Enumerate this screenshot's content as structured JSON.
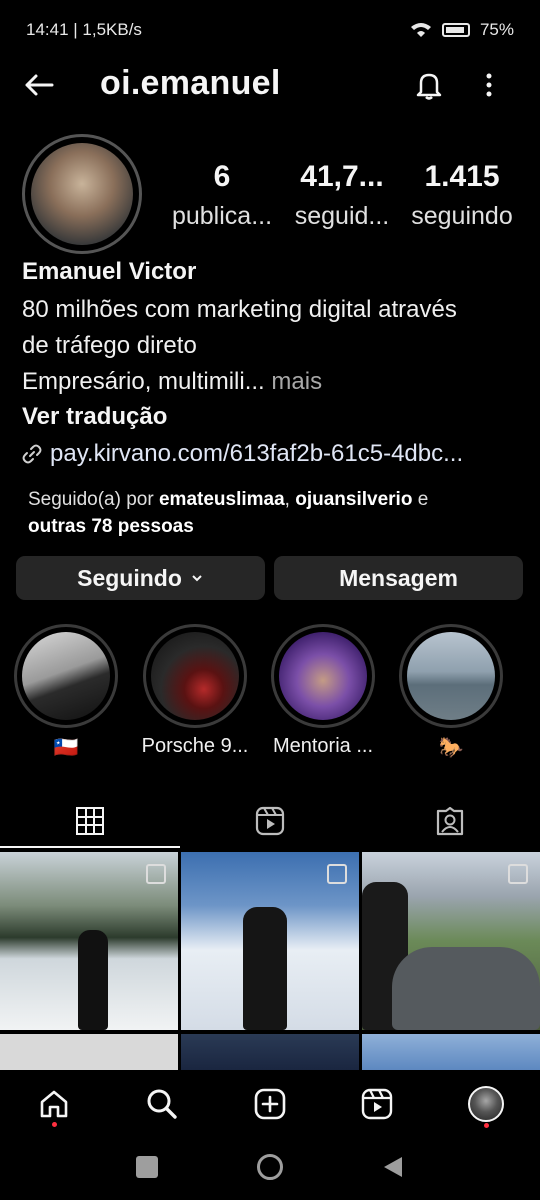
{
  "status": {
    "time_speed": "14:41 | 1,5KB/s",
    "battery": "75",
    "battery_level": 0.75
  },
  "header": {
    "username": "oi.emanuel"
  },
  "stats": [
    {
      "value": "6",
      "label": "publica..."
    },
    {
      "value": "41,7...",
      "label": "seguid..."
    },
    {
      "value": "1.415",
      "label": "seguindo"
    }
  ],
  "profile": {
    "name": "Emanuel Victor",
    "bio_line1": "80 milhões com marketing digital através",
    "bio_line2": "de tráfego direto",
    "bio_line3": "Empresário, multimili...",
    "more": "mais",
    "translate": "Ver tradução",
    "link": "pay.kirvano.com/613faf2b-61c5-4dbc..."
  },
  "followed_by": {
    "prefix": "Seguido(a) por",
    "user1": "emateuslimaa",
    "sep": ",",
    "user2": "ojuansilverio",
    "and": "e",
    "others": "outras 78 pessoas"
  },
  "buttons": {
    "following": "Seguindo",
    "message": "Mensagem"
  },
  "highlights": [
    {
      "label": "🇨🇱"
    },
    {
      "label": "Porsche 9..."
    },
    {
      "label": "Mentoria ..."
    },
    {
      "label": "🐎"
    }
  ],
  "colors": {
    "background": "#000000",
    "button": "#262626",
    "notification": "#ff3040"
  },
  "icons": [
    "back-arrow-icon",
    "bell-icon",
    "more-icon",
    "link-icon",
    "chevron-down-icon",
    "grid-icon",
    "reels-icon",
    "tagged-icon",
    "home-icon",
    "search-icon",
    "create-icon",
    "reels-nav-icon",
    "profile-avatar-icon"
  ]
}
